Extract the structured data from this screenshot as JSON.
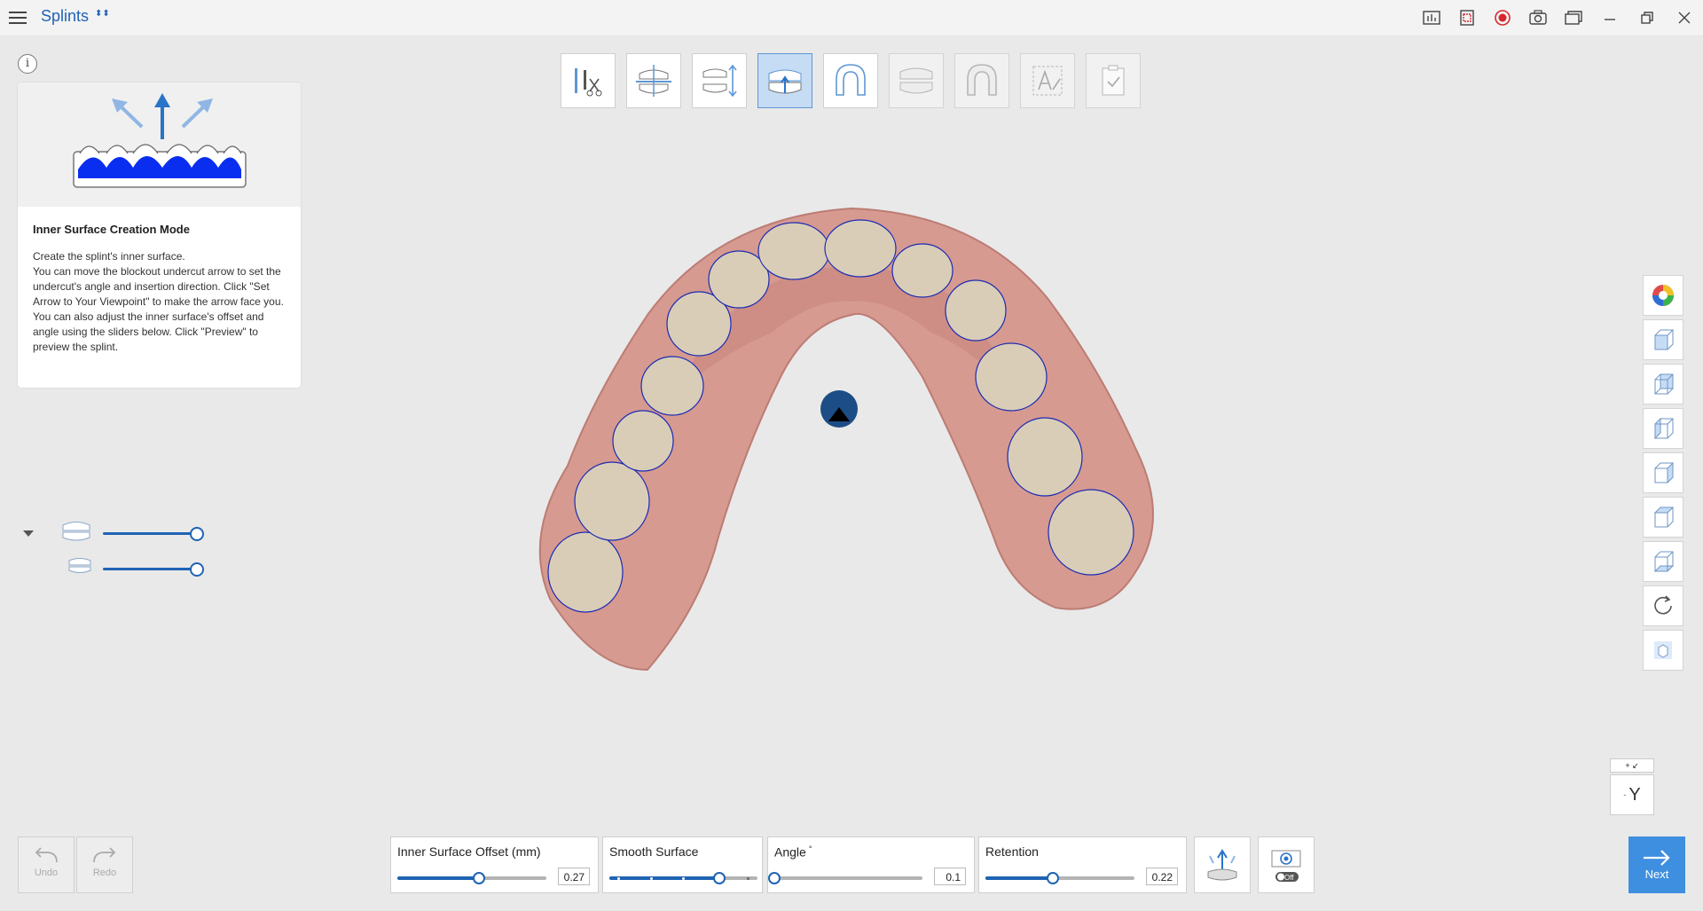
{
  "app": {
    "title": "Splints",
    "badge": "⬍⬍"
  },
  "info_button": "i",
  "help": {
    "title": "Inner Surface Creation Mode",
    "lines": [
      "Create the splint's inner surface.",
      "You can move the blockout undercut arrow to set the undercut's angle and insertion direction. Click \"Set Arrow to Your Viewpoint\" to make the arrow face you.",
      "You can also adjust the inner surface's offset and angle using the sliders below. Click \"Preview\" to preview the splint."
    ]
  },
  "workflow_steps": [
    {
      "name": "trim-step",
      "icon": "tools-scissors-icon",
      "state": "normal"
    },
    {
      "name": "align-step",
      "icon": "occlusal-plane-icon",
      "state": "normal"
    },
    {
      "name": "occlusion-step",
      "icon": "jaw-opening-icon",
      "state": "normal"
    },
    {
      "name": "inner-surface-step",
      "icon": "inner-surface-arrow-icon",
      "state": "active"
    },
    {
      "name": "outline-step",
      "icon": "arch-outline-icon",
      "state": "normal"
    },
    {
      "name": "outer-surface-step",
      "icon": "outer-surface-icon",
      "state": "disabled"
    },
    {
      "name": "finalize-shape-step",
      "icon": "splint-shape-icon",
      "state": "disabled"
    },
    {
      "name": "text-step",
      "icon": "text-label-icon",
      "state": "disabled"
    },
    {
      "name": "finish-step",
      "icon": "checklist-icon",
      "state": "disabled"
    }
  ],
  "layers": [
    {
      "name": "upper-jaw-layer",
      "icon": "upper-jaw-icon",
      "opacity": 1.0
    },
    {
      "name": "lower-jaw-layer",
      "icon": "lower-jaw-icon",
      "opacity": 1.0
    }
  ],
  "view_tools": [
    {
      "name": "color-wheel-icon"
    },
    {
      "name": "cube-front-icon"
    },
    {
      "name": "cube-back-icon"
    },
    {
      "name": "cube-left-icon"
    },
    {
      "name": "cube-right-icon"
    },
    {
      "name": "cube-top-icon"
    },
    {
      "name": "cube-bottom-icon"
    },
    {
      "name": "rotate-icon"
    },
    {
      "name": "cube-small-icon"
    }
  ],
  "axis": {
    "top": "+ ↙",
    "minus": "-",
    "label": "Y"
  },
  "history": {
    "undo": "Undo",
    "redo": "Redo"
  },
  "controls": {
    "offset": {
      "label": "Inner Surface Offset (mm)",
      "value": "0.27",
      "fraction": 0.55
    },
    "smooth": {
      "label": "Smooth Surface",
      "fraction": 0.74
    },
    "angle": {
      "label": "Angle",
      "superscript": "°",
      "value": "0.1",
      "fraction": 0.0
    },
    "retention": {
      "label": "Retention",
      "value": "0.22",
      "fraction": 0.45
    }
  },
  "next": {
    "label": "Next"
  },
  "colors": {
    "accent": "#1f63b3",
    "active_step": "#c6dcf5",
    "next_button": "#3f8fe0",
    "gum": "#d69a90",
    "tooth": "#d9cdb8",
    "record": "#d8262b"
  }
}
